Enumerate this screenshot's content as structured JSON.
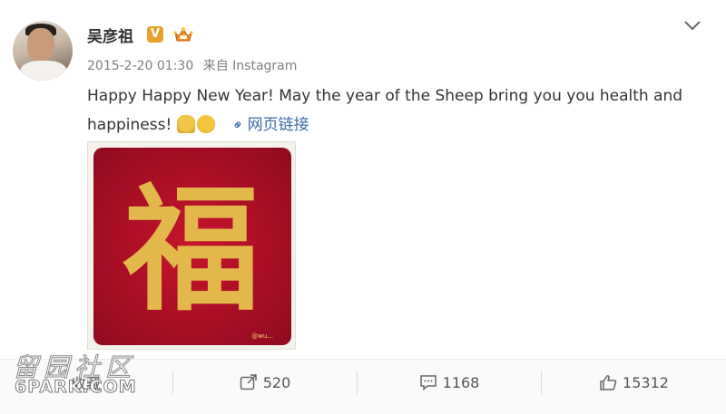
{
  "post": {
    "username": "吴彦祖",
    "verified_badge": "V",
    "member_icon": "crown-icon",
    "date": "2015-2-20 01:30",
    "source": "来自 Instagram",
    "text": "Happy Happy New Year! May the year of the Sheep bring you you health and happiness!",
    "emojis": [
      "pray-emoji-icon",
      "fist-emoji-icon"
    ],
    "link_label": "网页链接",
    "image": {
      "character": "福",
      "small_caption": "@wu..."
    }
  },
  "actions": {
    "favorite_label": "收藏",
    "repost_count": "520",
    "comment_count": "1168",
    "like_count": "15312"
  },
  "watermark": {
    "chinese": "留园社区",
    "english": "6PARK.COM"
  },
  "colors": {
    "link_blue": "#3d6ca8",
    "badge_orange": "#e8a12c",
    "image_red": "#c3102b",
    "gold": "#e3b84b"
  }
}
